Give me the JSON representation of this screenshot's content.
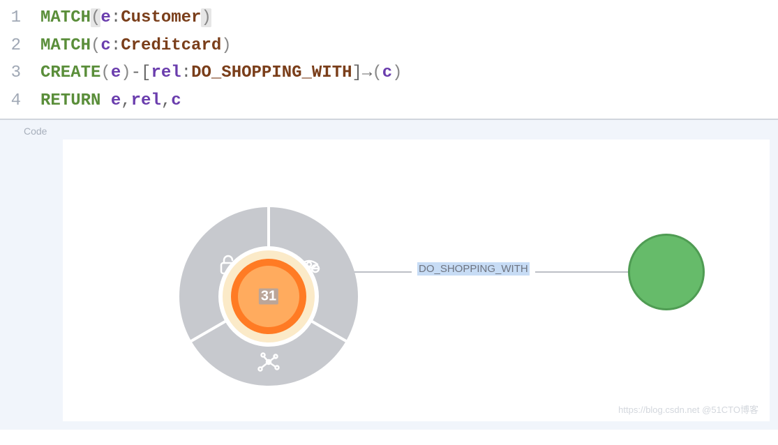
{
  "code": {
    "lines": [
      "1",
      "2",
      "3",
      "4"
    ],
    "l1": {
      "kw": "MATCH",
      "lp": "(",
      "id": "e",
      "colon": ":",
      "label": "Customer",
      "rp": ")"
    },
    "l2": {
      "kw": "MATCH",
      "lp": "(",
      "id": "c",
      "colon": ":",
      "label": "Creditcard",
      "rp": ")"
    },
    "l3": {
      "kw": "CREATE",
      "lp1": "(",
      "id1": "e",
      "rp1": ")",
      "dash1": "-",
      "lb": "[",
      "rel": "rel",
      "colon": ":",
      "reltype": "DO_SHOPPING_WITH",
      "rb": "]",
      "arrow": "→",
      "lp2": "(",
      "id2": "c",
      "rp2": ")"
    },
    "l4": {
      "kw": "RETURN",
      "sp": " ",
      "id1": "e",
      "c1": ",",
      "id2": "rel",
      "c2": ",",
      "id3": "c"
    }
  },
  "panel": {
    "sidebar_label": "Code",
    "center_node_value": "31",
    "edge_label": "DO_SHOPPING_WITH",
    "watermark": "https://blog.csdn.net  @51CTO博客"
  }
}
